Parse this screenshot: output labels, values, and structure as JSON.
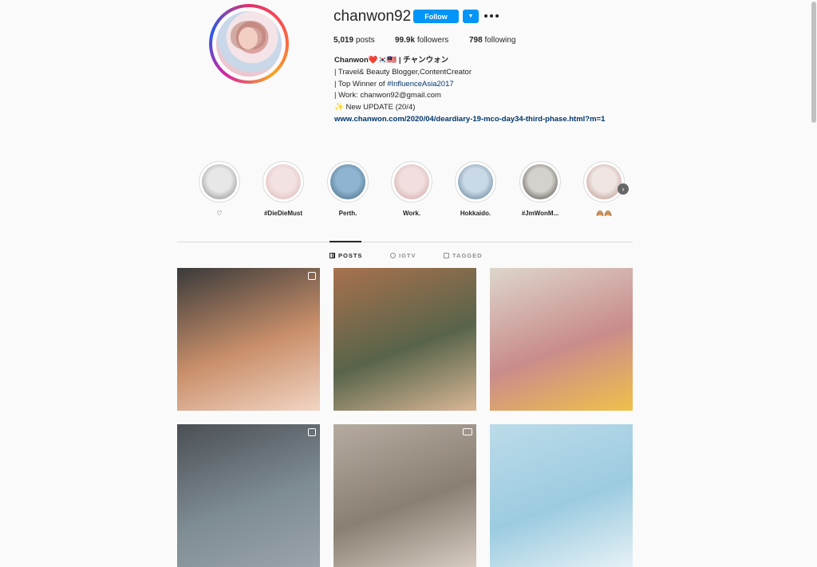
{
  "profile": {
    "username": "chanwon92",
    "follow_label": "Follow",
    "dropdown_glyph": "▼",
    "stats": {
      "posts_count": "5,019",
      "posts_label": "posts",
      "followers_count": "99.9k",
      "followers_label": "followers",
      "following_count": "798",
      "following_label": "following"
    },
    "bio": {
      "name": "Chanwon❤️🇰🇷🇲🇾 | チャンウォン",
      "line1": "| Travel& Beauty Blogger,ContentCreator",
      "line2_prefix": "| Top Winner of ",
      "line2_hashtag": "#InfluenceAsia2017",
      "line3": "| Work: chanwon92@gmail.com",
      "line4": "✨ New UPDATE (20/4)",
      "link": "www.chanwon.com/2020/04/deardiary-19-mco-day34-third-phase.html?m=1"
    }
  },
  "highlights": [
    {
      "label": "♡",
      "colors": [
        "#e7e7e7",
        "#7c7c7c"
      ]
    },
    {
      "label": "#DieDieMust",
      "colors": [
        "#f3e2e2",
        "#d7b0ad"
      ]
    },
    {
      "label": "Perth.",
      "colors": [
        "#8fb4cf",
        "#3a5e7a"
      ]
    },
    {
      "label": "Work.",
      "colors": [
        "#f1dede",
        "#c99d9e"
      ]
    },
    {
      "label": "Hokkaido.",
      "colors": [
        "#c9d9e6",
        "#4d6d87"
      ]
    },
    {
      "label": "#JmWonM...",
      "colors": [
        "#d5d2cd",
        "#3a3330"
      ]
    },
    {
      "label": "🙈🙈",
      "colors": [
        "#efe6e3",
        "#b08678"
      ]
    }
  ],
  "highlight_next_glyph": "›",
  "tabs": [
    {
      "label": "POSTS",
      "icon": "grid-icon",
      "active": true
    },
    {
      "label": "IGTV",
      "icon": "igtv-icon",
      "active": false
    },
    {
      "label": "TAGGED",
      "icon": "tagged-icon",
      "active": false
    }
  ],
  "posts": [
    {
      "type": "multi-image",
      "colors": [
        "#3a3a3a",
        "#c98f6a",
        "#f2d5c4"
      ]
    },
    {
      "type": "image",
      "colors": [
        "#a8714e",
        "#58644a",
        "#d9b796"
      ]
    },
    {
      "type": "image",
      "colors": [
        "#ddd6cc",
        "#c98c8c",
        "#f0c04a"
      ]
    },
    {
      "type": "multi-image",
      "colors": [
        "#4b4f54",
        "#7e8c93",
        "#9aa4aa"
      ]
    },
    {
      "type": "video",
      "colors": [
        "#b6aba0",
        "#8a7f73",
        "#d7ccc1"
      ]
    },
    {
      "type": "image",
      "colors": [
        "#bcdbe9",
        "#9ccbe0",
        "#e6f1f6"
      ]
    }
  ]
}
